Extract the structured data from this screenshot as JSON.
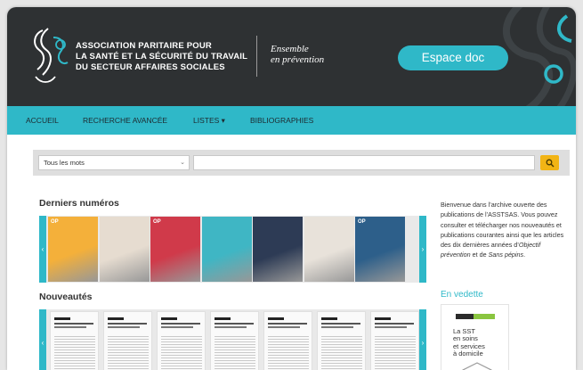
{
  "header": {
    "org_lines": [
      "ASSOCIATION PARITAIRE POUR",
      "LA SANTÉ ET LA SÉCURITÉ DU TRAVAIL",
      "DU SECTEUR AFFAIRES SOCIALES"
    ],
    "tagline_lines": [
      "Ensemble",
      "en prévention"
    ],
    "espace_doc_label": "Espace doc"
  },
  "nav": {
    "items": [
      "ACCUEIL",
      "RECHERCHE AVANCÉE",
      "LISTES",
      "BIBLIOGRAPHIES"
    ],
    "listes_caret": "▾"
  },
  "search": {
    "scope_value": "Tous les mots",
    "input_value": "",
    "button_icon": "magnifier-icon"
  },
  "derniers_numeros": {
    "title": "Derniers numéros",
    "cover_labels": [
      "OP",
      "",
      "OP",
      "",
      "",
      "",
      "OP"
    ],
    "cover_colors": [
      "#f4b03a",
      "#e6dcd0",
      "#d03a4a",
      "#3fb6c4",
      "#2d3b55",
      "#e8e2da",
      "#2d5f8a"
    ]
  },
  "nouveautes": {
    "title": "Nouveautés",
    "page_count": 7
  },
  "sidebar": {
    "intro_parts": [
      "Bienvenue dans l’archive ouverte des publications de l’ASSTSAS. Vous pouvez consulter et télécharger nos nouveautés et publications courantes ainsi que les articles des dix dernières années d’",
      "Objectif prévention",
      " et de ",
      "Sans pépins",
      "."
    ],
    "en_vedette": "En vedette",
    "vedette_title_lines": [
      "La SST",
      "en soins",
      "et services",
      "à domicile"
    ]
  },
  "colors": {
    "accent": "#2fb8c8",
    "header_bg": "#2e3133",
    "search_button": "#f2b415"
  }
}
